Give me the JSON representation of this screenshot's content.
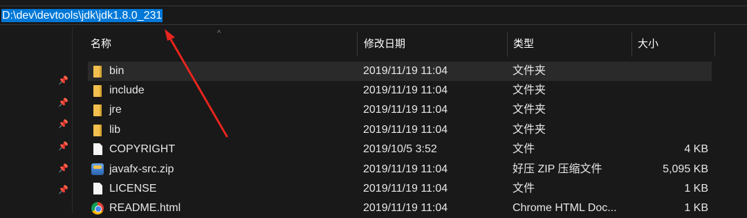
{
  "address": {
    "path": "D:\\dev\\devtools\\jdk\\jdk1.8.0_231"
  },
  "header": {
    "sort_indicator": "^",
    "columns": [
      "名称",
      "修改日期",
      "类型",
      "大小"
    ]
  },
  "files": [
    {
      "name": "bin",
      "date": "2019/11/19 11:04",
      "type": "文件夹",
      "size": "",
      "icon": "folder-icon"
    },
    {
      "name": "include",
      "date": "2019/11/19 11:04",
      "type": "文件夹",
      "size": "",
      "icon": "folder-icon"
    },
    {
      "name": "jre",
      "date": "2019/11/19 11:04",
      "type": "文件夹",
      "size": "",
      "icon": "folder-icon"
    },
    {
      "name": "lib",
      "date": "2019/11/19 11:04",
      "type": "文件夹",
      "size": "",
      "icon": "folder-icon"
    },
    {
      "name": "COPYRIGHT",
      "date": "2019/10/5 3:52",
      "type": "文件",
      "size": "4 KB",
      "icon": "document-icon"
    },
    {
      "name": "javafx-src.zip",
      "date": "2019/11/19 11:04",
      "type": "好压 ZIP 压缩文件",
      "size": "5,095 KB",
      "icon": "zip-archive-icon"
    },
    {
      "name": "LICENSE",
      "date": "2019/11/19 11:04",
      "type": "文件",
      "size": "1 KB",
      "icon": "document-icon"
    },
    {
      "name": "README.html",
      "date": "2019/11/19 11:04",
      "type": "Chrome HTML Doc...",
      "size": "1 KB",
      "icon": "chrome-icon"
    }
  ],
  "quick_access_pins": 6,
  "colors": {
    "selection": "#0078d7",
    "annotation_arrow": "#e8251d",
    "background": "#191919"
  }
}
